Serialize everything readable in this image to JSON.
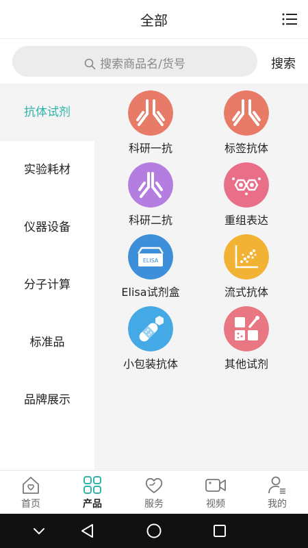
{
  "header": {
    "title": "全部",
    "menu_icon": "list-menu-icon"
  },
  "search": {
    "placeholder": "搜索商品名/货号",
    "button_label": "搜索",
    "icon": "search-icon"
  },
  "sidebar": {
    "items": [
      {
        "label": "抗体试剂",
        "active": true
      },
      {
        "label": "实验耗材",
        "active": false
      },
      {
        "label": "仪器设备",
        "active": false
      },
      {
        "label": "分子计算",
        "active": false
      },
      {
        "label": "标准品",
        "active": false
      },
      {
        "label": "品牌展示",
        "active": false
      }
    ]
  },
  "products": [
    {
      "label": "科研一抗",
      "icon": "antibody-icon",
      "color": "#e87a68"
    },
    {
      "label": "标签抗体",
      "icon": "antibody-icon",
      "color": "#e87a68"
    },
    {
      "label": "科研二抗",
      "icon": "antibody-icon",
      "color": "#b47ee0"
    },
    {
      "label": "重组表达",
      "icon": "molecule-icon",
      "color": "#e86f87"
    },
    {
      "label": "Elisa试剂盒",
      "icon": "elisa-box-icon",
      "color": "#3d8fd9",
      "badge": "ELISA"
    },
    {
      "label": "流式抗体",
      "icon": "flow-plot-icon",
      "color": "#f2b234"
    },
    {
      "label": "小包装抗体",
      "icon": "small-package-icon",
      "color": "#45a9e6"
    },
    {
      "label": "其他试剂",
      "icon": "reagent-blocks-icon",
      "color": "#e87683"
    }
  ],
  "tabbar": {
    "items": [
      {
        "label": "首页",
        "icon": "home-icon",
        "active": false
      },
      {
        "label": "产品",
        "icon": "grid-icon",
        "active": true
      },
      {
        "label": "服务",
        "icon": "heart-icon",
        "active": false
      },
      {
        "label": "视频",
        "icon": "video-camera-icon",
        "active": false
      },
      {
        "label": "我的",
        "icon": "user-icon",
        "active": false
      }
    ]
  },
  "colors": {
    "accent": "#2eb3a9",
    "content_bg": "#f4f4f4",
    "nav_bar": "#111111"
  }
}
